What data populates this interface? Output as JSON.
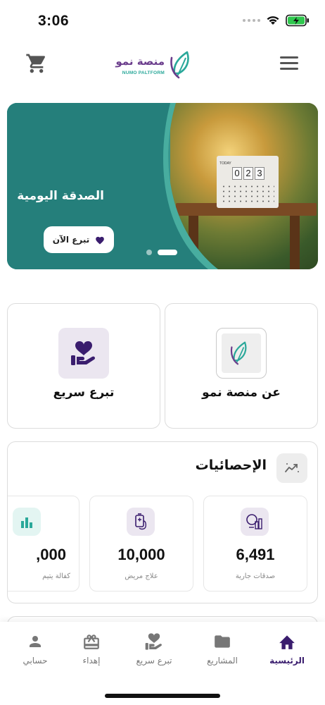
{
  "status_bar": {
    "time": "3:06"
  },
  "header": {
    "logo_text_ar": "منصة نمو",
    "logo_text_en": "NUMO PALTFORM",
    "icons": [
      "cart-icon",
      "logo-mark-icon",
      "hamburger-menu-icon"
    ]
  },
  "banner": {
    "title": "الصدقة اليومية",
    "button_label": "تبرع الآن",
    "calendar_today": "TODAY",
    "calendar_digits": [
      "0",
      "2",
      "3"
    ],
    "slides_count": 2,
    "active_slide": 1
  },
  "quick_cards": [
    {
      "label": "عن منصة نمو",
      "icon": "logo-mark-icon"
    },
    {
      "label": "تبرع سريع",
      "icon": "heart-hand-icon"
    }
  ],
  "statistics": {
    "title": "الإحصائيات",
    "icon": "trend-chart-icon",
    "items": [
      {
        "value": "6,491",
        "label": "صدقات جارية",
        "icon": "ongoing-charity-icon"
      },
      {
        "value": "10,000",
        "label": "علاج مريض",
        "icon": "patient-treatment-icon"
      },
      {
        "value": ",000",
        "label": "كفالة يتيم",
        "icon": "bar-chart-icon"
      }
    ]
  },
  "bottom_nav": {
    "items": [
      {
        "label": "الرئيسية",
        "icon": "home-icon",
        "active": true
      },
      {
        "label": "المشاريع",
        "icon": "folder-icon",
        "active": false
      },
      {
        "label": "تبرع سريع",
        "icon": "heart-hand-icon",
        "active": false
      },
      {
        "label": "إهداء",
        "icon": "gift-icon",
        "active": false
      },
      {
        "label": "حسابي",
        "icon": "person-icon",
        "active": false
      }
    ]
  },
  "colors": {
    "primary_purple": "#3a1d6e",
    "brand_teal": "#2aa89a",
    "banner_teal": "#1f7f7a"
  }
}
